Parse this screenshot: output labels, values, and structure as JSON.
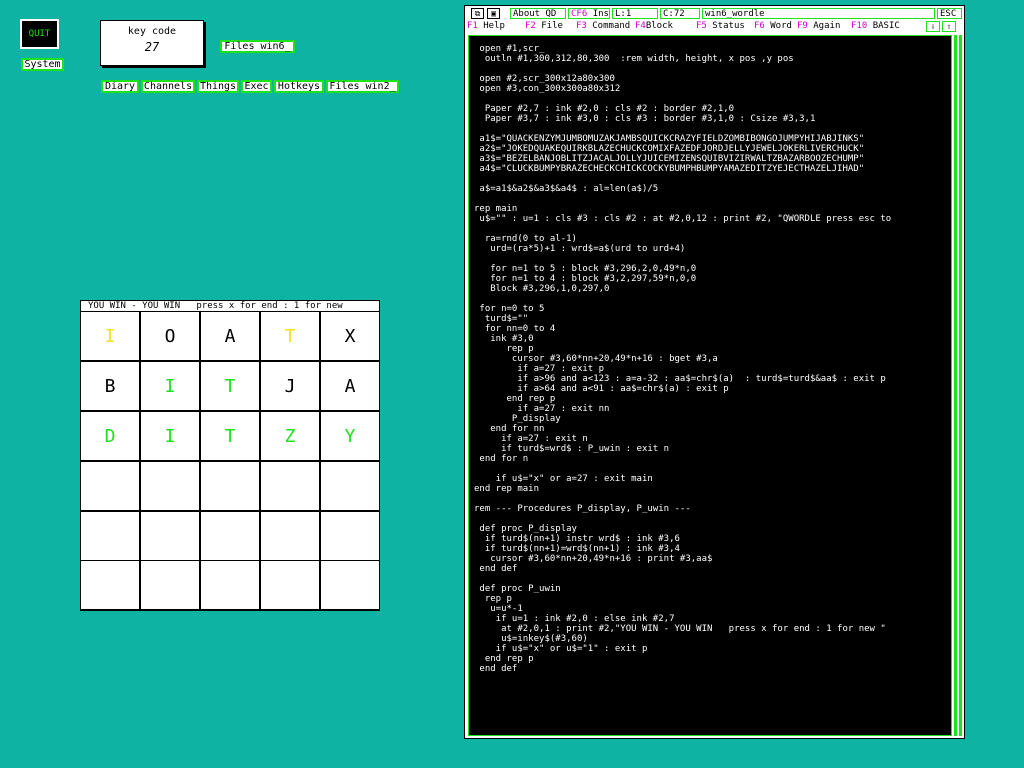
{
  "desktop": {
    "quit_label": "QUIT",
    "system_label": "System",
    "keycode": {
      "label": "key code",
      "value": "27"
    },
    "files_win6_label": "Files win6_",
    "toolbar": [
      "Diary",
      "Channels",
      "Things",
      "Exec",
      "Hotkeys",
      "Files win2_"
    ]
  },
  "wordle": {
    "title": "YOU WIN - YOU WIN   press x for end : 1 for new",
    "rows": [
      [
        {
          "l": "I",
          "s": "yellow"
        },
        {
          "l": "O",
          "s": "none"
        },
        {
          "l": "A",
          "s": "none"
        },
        {
          "l": "T",
          "s": "yellow"
        },
        {
          "l": "X",
          "s": "none"
        }
      ],
      [
        {
          "l": "B",
          "s": "none"
        },
        {
          "l": "I",
          "s": "green"
        },
        {
          "l": "T",
          "s": "green"
        },
        {
          "l": "J",
          "s": "none"
        },
        {
          "l": "A",
          "s": "none"
        }
      ],
      [
        {
          "l": "D",
          "s": "green"
        },
        {
          "l": "I",
          "s": "green"
        },
        {
          "l": "T",
          "s": "green"
        },
        {
          "l": "Z",
          "s": "green"
        },
        {
          "l": "Y",
          "s": "green"
        }
      ],
      [
        {
          "l": "",
          "s": "none"
        },
        {
          "l": "",
          "s": "none"
        },
        {
          "l": "",
          "s": "none"
        },
        {
          "l": "",
          "s": "none"
        },
        {
          "l": "",
          "s": "none"
        }
      ],
      [
        {
          "l": "",
          "s": "none"
        },
        {
          "l": "",
          "s": "none"
        },
        {
          "l": "",
          "s": "none"
        },
        {
          "l": "",
          "s": "none"
        },
        {
          "l": "",
          "s": "none"
        }
      ],
      [
        {
          "l": "",
          "s": "none"
        },
        {
          "l": "",
          "s": "none"
        },
        {
          "l": "",
          "s": "none"
        },
        {
          "l": "",
          "s": "none"
        },
        {
          "l": "",
          "s": "none"
        }
      ]
    ]
  },
  "editor": {
    "about": "About QD",
    "ins_key": "CF6",
    "ins": "Ins",
    "line": "L:1",
    "col": "C:72",
    "filename": "win6_wordle",
    "esc": "ESC",
    "menu": [
      {
        "key": "F1",
        "label": "Help"
      },
      {
        "key": "F2",
        "label": "File"
      },
      {
        "key": "F3",
        "label": "Command"
      },
      {
        "key": "F4",
        "label": "Block"
      },
      {
        "key": "F5",
        "label": "Status"
      },
      {
        "key": "F6",
        "label": "Word"
      },
      {
        "key": "F9",
        "label": "Again"
      },
      {
        "key": "F10",
        "label": "BASIC"
      }
    ],
    "code": " open #1,scr_\n  outln #1,300,312,80,300  :rem width, height, x pos ,y pos\n\n open #2,scr_300x12a80x300\n open #3,con_300x300a80x312\n\n  Paper #2,7 : ink #2,0 : cls #2 : border #2,1,0\n  Paper #3,7 : ink #3,0 : cls #3 : border #3,1,0 : Csize #3,3,1\n\n a1$=\"QUACKENZYMJUMBOMUZAKJAMBSQUICKCRAZYFIELDZOMBIBONGOJUMPYHIJABJINKS\"\n a2$=\"JOKEDQUAKEQUIRKBLAZECHUCKCOMIXFAZEDFJORDJELLYJEWELJOKERLIVERCHUCK\"\n a3$=\"BEZELBANJOBLITZJACALJOLLYJUICEMIZENSQUIBVIZIRWALTZBAZARBOOZECHUMP\"\n a4$=\"CLUCKBUMPYBRAZECHECKCHICKCOCKYBUMPHBUMPYAMAZEDITZYEJECTHAZELJIHAD\"\n\n a$=a1$&a2$&a3$&a4$ : al=len(a$)/5\n\nrep main\n u$=\"\" : u=1 : cls #3 : cls #2 : at #2,0,12 : print #2, \"QWORDLE press esc to\n\n  ra=rnd(0 to al-1)\n   urd=(ra*5)+1 : wrd$=a$(urd to urd+4)\n\n   for n=1 to 5 : block #3,296,2,0,49*n,0\n   for n=1 to 4 : block #3,2,297,59*n,0,0\n   Block #3,296,1,0,297,0\n\n for n=0 to 5\n  turd$=\"\"\n  for nn=0 to 4\n   ink #3,0\n      rep p\n       cursor #3,60*nn+20,49*n+16 : bget #3,a\n        if a=27 : exit p\n        if a>96 and a<123 : a=a-32 : aa$=chr$(a)  : turd$=turd$&aa$ : exit p\n        if a>64 and a<91 : aa$=chr$(a) : exit p\n      end rep p\n        if a=27 : exit nn\n       P_display\n   end for nn\n     if a=27 : exit n\n     if turd$=wrd$ : P_uwin : exit n\n end for n\n\n    if u$=\"x\" or a=27 : exit main\nend rep main\n\nrem --- Procedures P_display, P_uwin ---\n\n def proc P_display\n  if turd$(nn+1) instr wrd$ : ink #3,6\n  if turd$(nn+1)=wrd$(nn+1) : ink #3,4\n   cursor #3,60*nn+20,49*n+16 : print #3,aa$\n end def\n\n def proc P_uwin\n  rep p\n   u=u*-1\n    if u=1 : ink #2,0 : else ink #2,7\n     at #2,0,1 : print #2,\"YOU WIN - YOU WIN   press x for end : 1 for new \"\n     u$=inkey$(#3,60)\n    if u$=\"x\" or u$=\"1\" : exit p\n  end rep p\n end def"
  },
  "colors": {
    "desktop_bg": "#0fb3a3",
    "accent_green": "#1fe21f",
    "yellow": "#f0e12a",
    "fkey_magenta": "#d000d0"
  }
}
